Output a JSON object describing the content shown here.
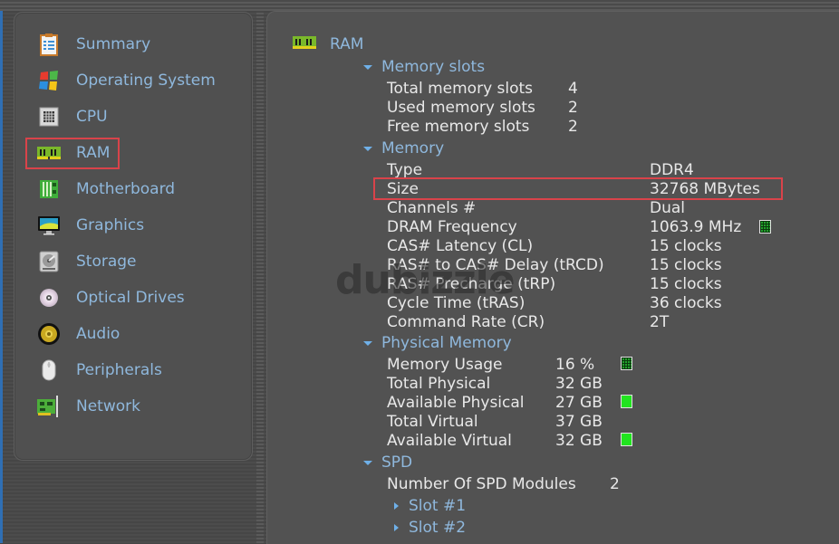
{
  "sidebar": {
    "items": [
      {
        "label": "Summary",
        "icon": "clipboard-icon"
      },
      {
        "label": "Operating System",
        "icon": "windows-logo-icon"
      },
      {
        "label": "CPU",
        "icon": "cpu-chip-icon"
      },
      {
        "label": "RAM",
        "icon": "ram-module-icon",
        "selected": true
      },
      {
        "label": "Motherboard",
        "icon": "motherboard-icon"
      },
      {
        "label": "Graphics",
        "icon": "monitor-icon"
      },
      {
        "label": "Storage",
        "icon": "hard-drive-icon"
      },
      {
        "label": "Optical Drives",
        "icon": "optical-disc-icon"
      },
      {
        "label": "Audio",
        "icon": "speaker-icon"
      },
      {
        "label": "Peripherals",
        "icon": "mouse-icon"
      },
      {
        "label": "Network",
        "icon": "network-card-icon"
      }
    ]
  },
  "main": {
    "title": "RAM",
    "memory_slots": {
      "header": "Memory slots",
      "rows": [
        {
          "label": "Total memory slots",
          "value": "4"
        },
        {
          "label": "Used memory slots",
          "value": "2"
        },
        {
          "label": "Free memory slots",
          "value": "2"
        }
      ]
    },
    "memory": {
      "header": "Memory",
      "rows": [
        {
          "label": "Type",
          "value": "DDR4"
        },
        {
          "label": "Size",
          "value": "32768 MBytes"
        },
        {
          "label": "Channels #",
          "value": "Dual"
        },
        {
          "label": "DRAM Frequency",
          "value": "1063.9 MHz"
        },
        {
          "label": "CAS# Latency (CL)",
          "value": "15 clocks"
        },
        {
          "label": "RAS# to CAS# Delay (tRCD)",
          "value": "15 clocks"
        },
        {
          "label": "RAS# Precharge (tRP)",
          "value": "15 clocks"
        },
        {
          "label": "Cycle Time (tRAS)",
          "value": "36 clocks"
        },
        {
          "label": "Command Rate (CR)",
          "value": "2T"
        }
      ]
    },
    "physical_memory": {
      "header": "Physical Memory",
      "rows": [
        {
          "label": "Memory Usage",
          "value": "16 %"
        },
        {
          "label": "Total Physical",
          "value": "32 GB"
        },
        {
          "label": "Available Physical",
          "value": "27 GB"
        },
        {
          "label": "Total Virtual",
          "value": "37 GB"
        },
        {
          "label": "Available Virtual",
          "value": "32 GB"
        }
      ]
    },
    "spd": {
      "header": "SPD",
      "modules_label": "Number Of SPD Modules",
      "modules_value": "2",
      "slots": [
        "Slot #1",
        "Slot #2"
      ]
    }
  },
  "watermark": "dubizzle",
  "colors": {
    "link_blue": "#8fb8dd",
    "highlight_red": "#d9434a",
    "meter_green": "#21e41f"
  }
}
